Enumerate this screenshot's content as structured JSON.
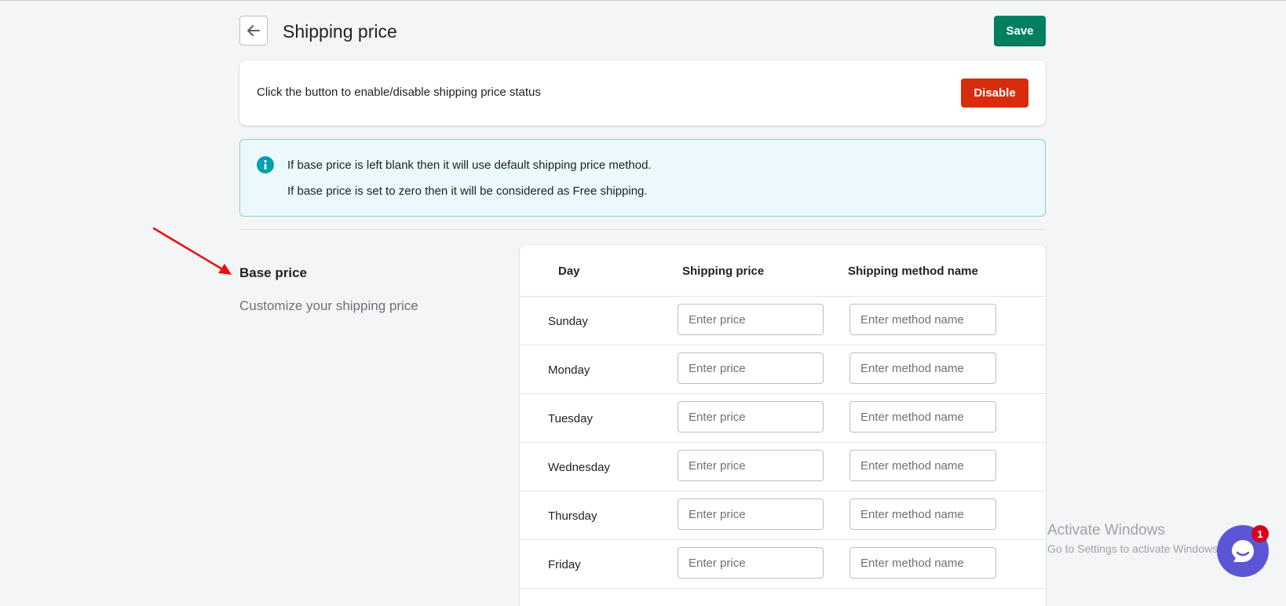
{
  "header": {
    "title": "Shipping price",
    "save_label": "Save"
  },
  "status_card": {
    "text": "Click the button to enable/disable shipping price status",
    "disable_label": "Disable"
  },
  "info_banner": {
    "line1": "If base price is left blank then it will use default shipping price method.",
    "line2": "If base price is set to zero then it will be considered as Free shipping."
  },
  "section": {
    "title": "Base price",
    "subtitle": "Customize your shipping price"
  },
  "table": {
    "headers": [
      "Day",
      "Shipping price",
      "Shipping method name"
    ],
    "price_placeholder": "Enter price",
    "method_placeholder": "Enter method name",
    "rows": [
      {
        "day": "Sunday",
        "price": "",
        "method": ""
      },
      {
        "day": "Monday",
        "price": "",
        "method": ""
      },
      {
        "day": "Tuesday",
        "price": "",
        "method": ""
      },
      {
        "day": "Wednesday",
        "price": "",
        "method": ""
      },
      {
        "day": "Thursday",
        "price": "",
        "method": ""
      },
      {
        "day": "Friday",
        "price": "",
        "method": ""
      }
    ]
  },
  "watermark": {
    "line1": "Activate Windows",
    "line2": "Go to Settings to activate Windows."
  },
  "chat": {
    "badge_count": "1"
  },
  "colors": {
    "primary": "#008060",
    "critical": "#d72c0d",
    "info_icon": "#00a0ac",
    "info_bg": "#ebf9fc",
    "chat": "#5b56d6",
    "annotation_arrow": "#e81010"
  },
  "icons": [
    "arrow-left-icon",
    "info-icon",
    "chat-icon",
    "annotation-arrow"
  ]
}
